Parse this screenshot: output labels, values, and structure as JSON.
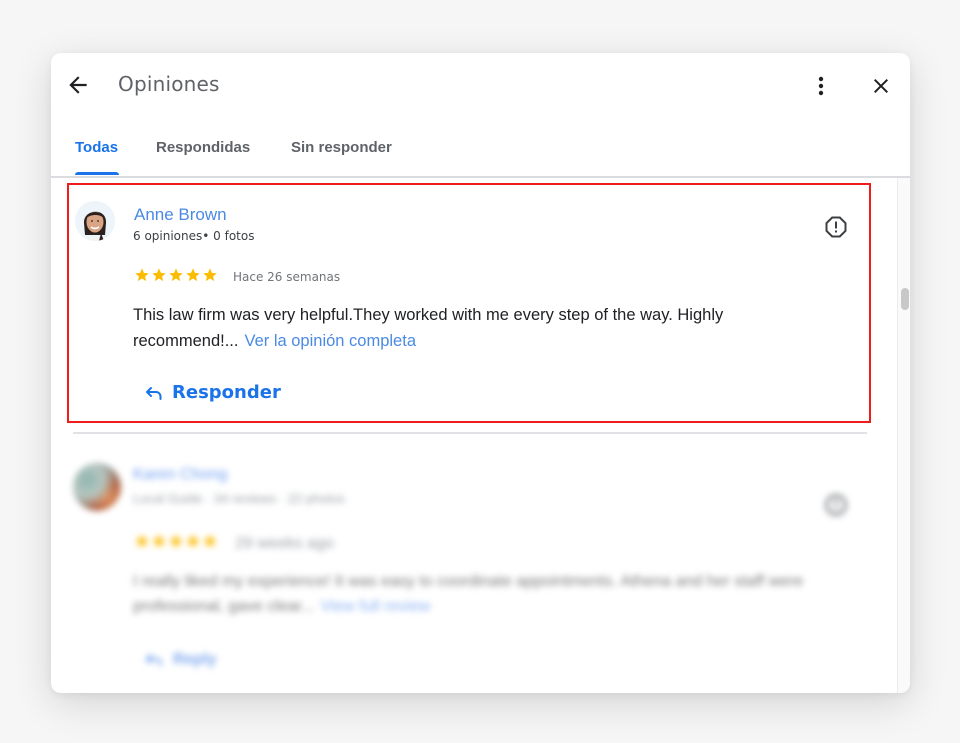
{
  "header": {
    "title": "Opiniones",
    "back_icon": "arrow-left-icon",
    "more_icon": "more-vertical-icon",
    "close_icon": "close-icon"
  },
  "tabs": [
    {
      "label": "Todas",
      "active": true
    },
    {
      "label": "Respondidas",
      "active": false
    },
    {
      "label": "Sin responder",
      "active": false
    }
  ],
  "colors": {
    "accent": "#1a73e8",
    "link": "#4a8ae4",
    "star": "#fbbc04",
    "highlight_border": "#ee1c1c"
  },
  "reviews": [
    {
      "name": "Anne Brown",
      "meta": "6 opiniones• 0 fotos",
      "rating": 5,
      "date": "Hace 26 semanas",
      "text": "This law firm was very helpful.They worked with me every step of the way. Highly recommend!...",
      "link": "Ver la opinión completa",
      "reply_label": "Responder",
      "highlighted": true,
      "flag_icon": "report-flag-icon"
    },
    {
      "name": "Karen Chong",
      "meta": "Local Guide · 34 reviews · 22 photos",
      "rating": 5,
      "date": "29 weeks ago",
      "text": "I really liked my experience! It was easy to coordinate appointments. Athena and her staff were professional, gave clear...",
      "link": "View full review",
      "reply_label": "Reply",
      "blurred": true,
      "flag_icon": "report-flag-icon"
    }
  ]
}
